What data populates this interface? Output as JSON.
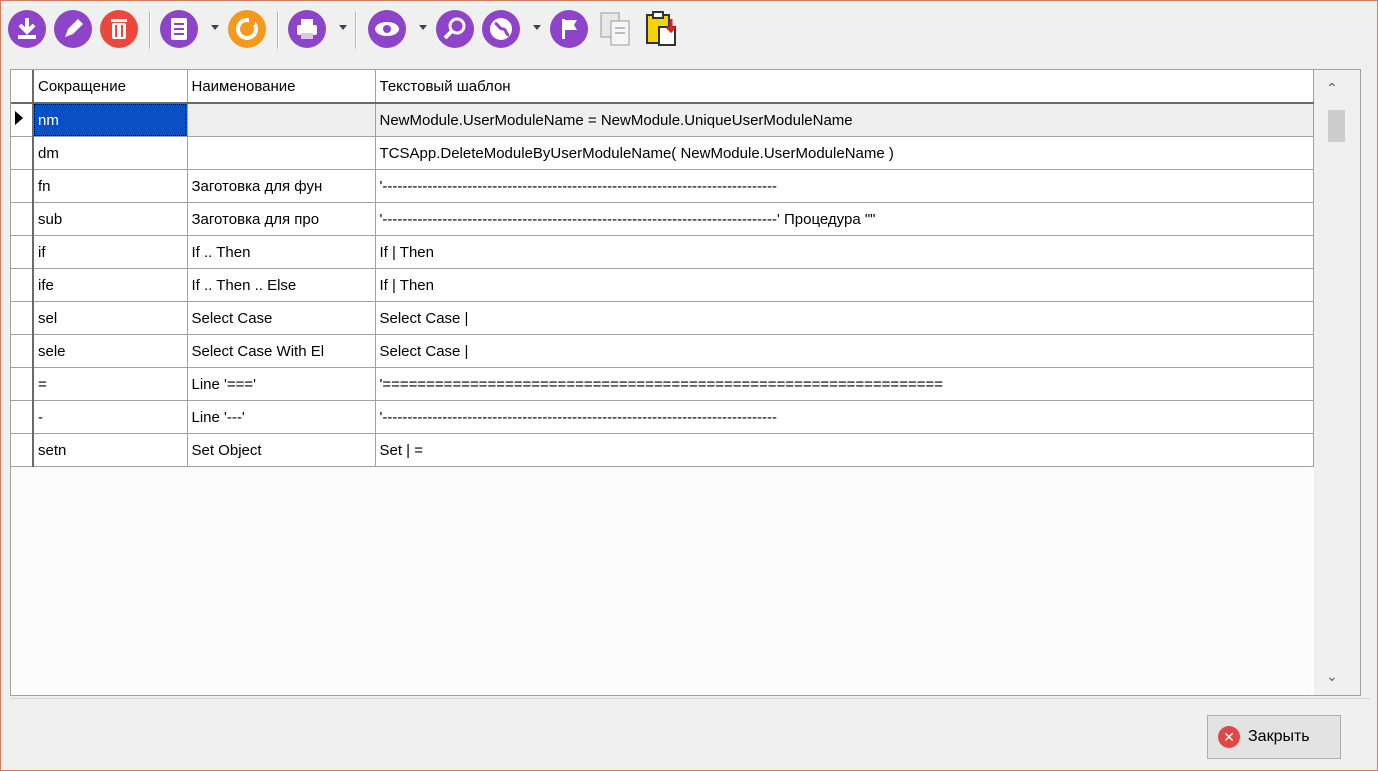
{
  "toolbar": {
    "icons": [
      "download-icon",
      "edit-icon",
      "delete-icon",
      "document-icon",
      "refresh-icon",
      "print-icon",
      "view-icon",
      "search-icon",
      "globe-icon",
      "flag-icon",
      "copy-icon",
      "clipboard-icon"
    ],
    "accent": "#8e44c9"
  },
  "grid": {
    "headers": [
      "Сокращение",
      "Наименование",
      "Текстовый шаблон"
    ],
    "rows": [
      {
        "abbr": "nm",
        "name": "",
        "template": "NewModule.UserModuleName = NewModule.UniqueUserModuleName"
      },
      {
        "abbr": "dm",
        "name": "",
        "template": "TCSApp.DeleteModuleByUserModuleName( NewModule.UserModuleName )"
      },
      {
        "abbr": "fn",
        "name": "Заготовка для фун",
        "template": "'-------------------------------------------------------------------------------"
      },
      {
        "abbr": "sub",
        "name": "Заготовка для про",
        "template": "'-------------------------------------------------------------------------------' Процедура \"\""
      },
      {
        "abbr": "if",
        "name": "If .. Then",
        "template": "If | Then"
      },
      {
        "abbr": "ife",
        "name": "If .. Then .. Else",
        "template": "If | Then"
      },
      {
        "abbr": "sel",
        "name": "Select Case",
        "template": "Select Case |"
      },
      {
        "abbr": "sele",
        "name": "Select Case With El",
        "template": "Select Case |"
      },
      {
        "abbr": "=",
        "name": "Line '==='",
        "template": "'================================================================"
      },
      {
        "abbr": "-",
        "name": "Line '---'",
        "template": "'-------------------------------------------------------------------------------"
      },
      {
        "abbr": "setn",
        "name": "Set Object",
        "template": "Set | ="
      }
    ]
  },
  "footer": {
    "close_label": "Закрыть"
  }
}
